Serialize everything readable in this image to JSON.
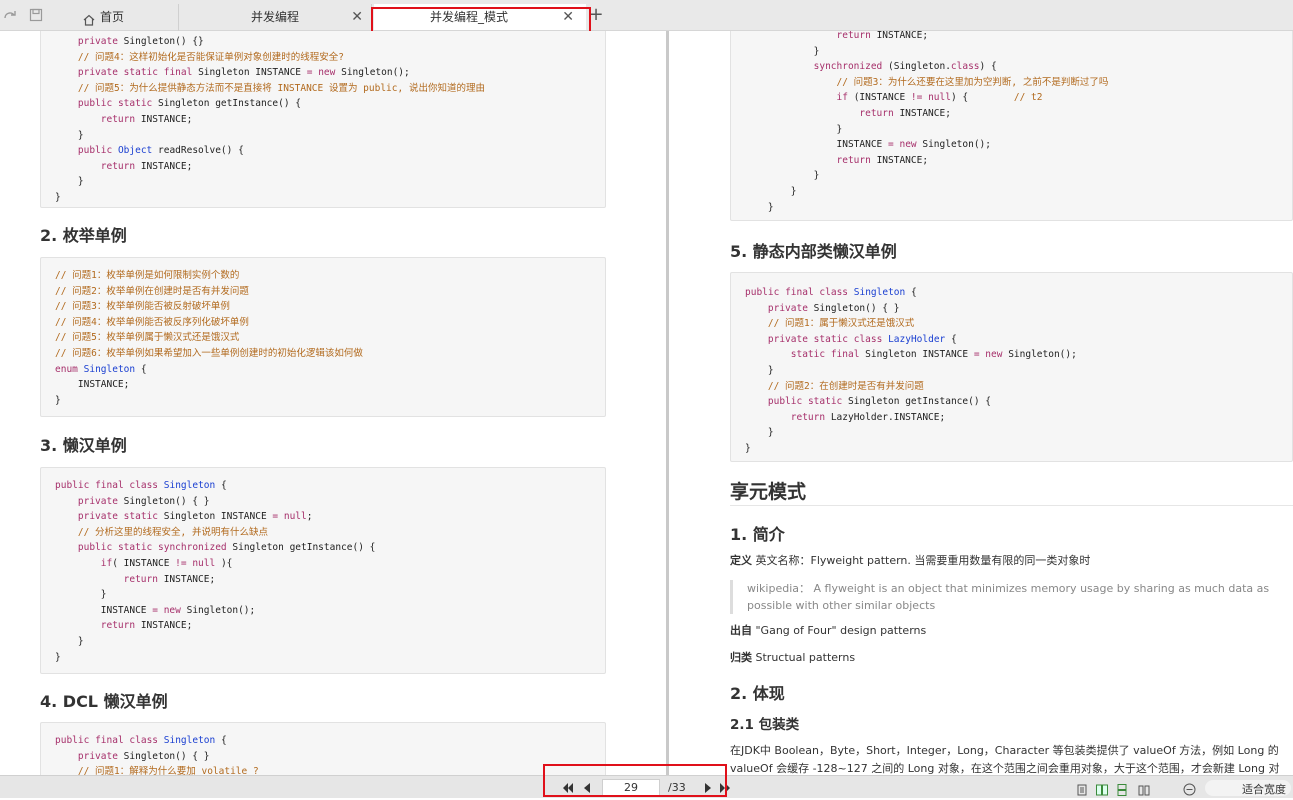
{
  "tabs": {
    "home": "首页",
    "tab2": "并发编程",
    "tab3": "并发编程_模式",
    "close_glyph": "✕",
    "add_glyph": "+"
  },
  "left": {
    "code1": [
      "    private Singleton() {}",
      "    // 问题4：这样初始化是否能保证单例对象创建时的线程安全?",
      "    private static final Singleton INSTANCE = new Singleton();",
      "    // 问题5：为什么提供静态方法而不是直接将 INSTANCE 设置为 public, 说出你知道的理由",
      "    public static Singleton getInstance() {",
      "        return INSTANCE;",
      "    }",
      "    public Object readResolve() {",
      "        return INSTANCE;",
      "    }",
      "}"
    ],
    "h_enum": "2. 枚举单例",
    "code2": [
      "// 问题1：枚举单例是如何限制实例个数的",
      "// 问题2：枚举单例在创建时是否有并发问题",
      "// 问题3：枚举单例能否被反射破坏单例",
      "// 问题4：枚举单例能否被反序列化破坏单例",
      "// 问题5：枚举单例属于懒汉式还是饿汉式",
      "// 问题6：枚举单例如果希望加入一些单例创建时的初始化逻辑该如何做",
      "enum Singleton {",
      "    INSTANCE;",
      "}"
    ],
    "h_lazy": "3. 懒汉单例",
    "code3": [
      "public final class Singleton {",
      "    private Singleton() { }",
      "    private static Singleton INSTANCE = null;",
      "    // 分析这里的线程安全, 并说明有什么缺点",
      "    public static synchronized Singleton getInstance() {",
      "        if( INSTANCE != null ){",
      "            return INSTANCE;",
      "        }",
      "        INSTANCE = new Singleton();",
      "        return INSTANCE;",
      "    }",
      "}"
    ],
    "h_dcl": "4. DCL 懒汉单例",
    "code4": [
      "public final class Singleton {",
      "    private Singleton() { }",
      "    // 问题1：解释为什么要加 volatile ?"
    ]
  },
  "right": {
    "code5": [
      "                return INSTANCE;",
      "            }",
      "            synchronized (Singleton.class) {",
      "                // 问题3：为什么还要在这里加为空判断, 之前不是判断过了吗",
      "                if (INSTANCE != null) {        // t2",
      "                    return INSTANCE;",
      "                }",
      "                INSTANCE = new Singleton();",
      "                return INSTANCE;",
      "            }",
      "        }",
      "    }"
    ],
    "h_static": "5. 静态内部类懒汉单例",
    "code6": [
      "public final class Singleton {",
      "    private Singleton() { }",
      "    // 问题1：属于懒汉式还是饿汉式",
      "    private static class LazyHolder {",
      "        static final Singleton INSTANCE = new Singleton();",
      "    }",
      "    // 问题2：在创建时是否有并发问题",
      "    public static Singleton getInstance() {",
      "        return LazyHolder.INSTANCE;",
      "    }",
      "}"
    ],
    "h_flyweight": "享元模式",
    "h_intro": "1. 简介",
    "def_label": "定义",
    "def_text": " 英文名称：Flyweight pattern. 当需要重用数量有限的同一类对象时",
    "quote_line1": "wikipedia： A flyweight is an object that minimizes memory usage by sharing as much data as",
    "quote_line2": "possible with other similar objects",
    "source_label": "出自",
    "source_text": " \"Gang of Four\" design patterns",
    "cat_label": "归类",
    "cat_text": " Structual patterns",
    "h_embody": "2. 体现",
    "h_wrapper": "2.1 包装类",
    "para1": "在JDK中 Boolean，Byte，Short，Integer，Long，Character 等包装类提供了 valueOf 方法，例如 Long 的",
    "para2": "valueOf 会缓存 -128~127 之间的 Long 对象，在这个范围之间会重用对象，大于这个范围，才会新建 Long 对"
  },
  "status": {
    "page_current": "29",
    "page_total": "/33",
    "fit_label": "适合宽度"
  },
  "colors": {
    "keyword": "#a6306b",
    "type": "#1a3fd1",
    "comment": "#b26a1e",
    "highlight": "#e0101a"
  }
}
